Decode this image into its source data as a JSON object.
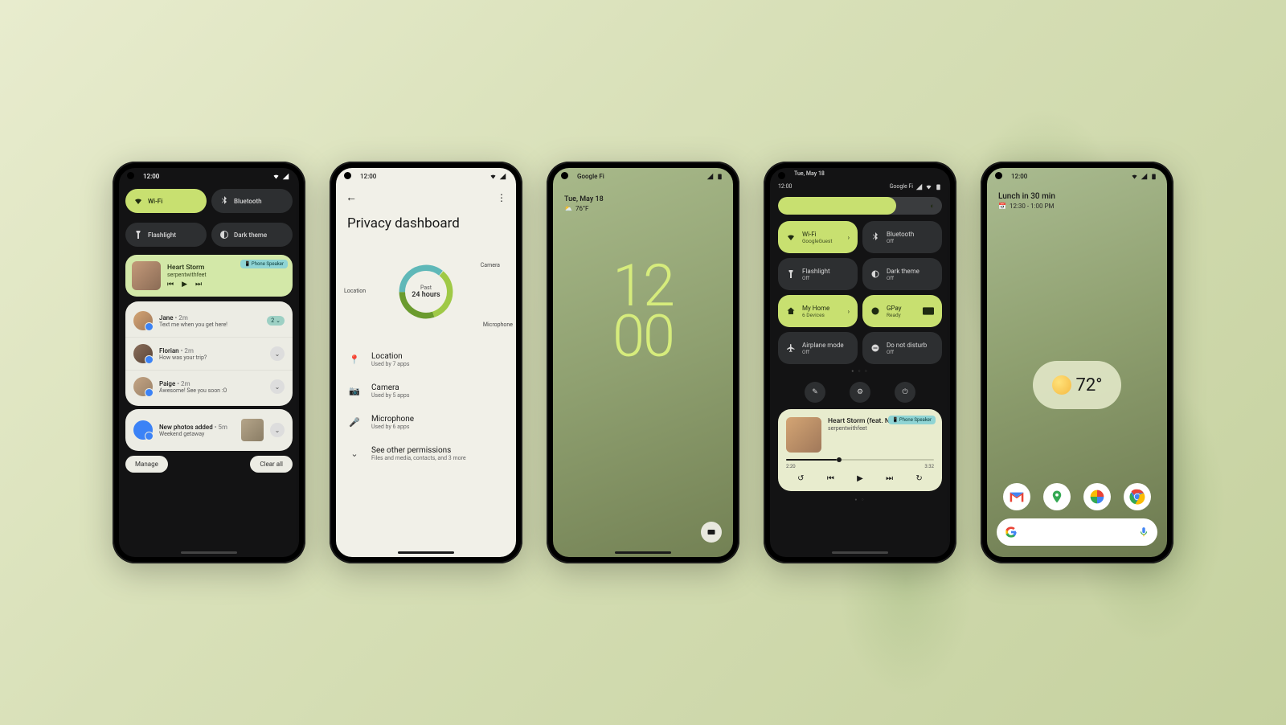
{
  "phone1": {
    "time": "12:00",
    "qs": [
      {
        "label": "Wi-Fi",
        "icon": "wifi-icon",
        "on": true
      },
      {
        "label": "Bluetooth",
        "icon": "bluetooth-icon",
        "on": false
      },
      {
        "label": "Flashlight",
        "icon": "flashlight-icon",
        "on": false
      },
      {
        "label": "Dark theme",
        "icon": "dark-theme-icon",
        "on": false
      }
    ],
    "media": {
      "title": "Heart Storm",
      "artist": "serpentwithfeet",
      "badge": "Phone Speaker"
    },
    "notifications": [
      {
        "name": "Jane",
        "meta": "• 2m",
        "text": "Text me when you get here!",
        "count": "2"
      },
      {
        "name": "Florian",
        "meta": "• 2m",
        "text": "How was your trip?"
      },
      {
        "name": "Paige",
        "meta": "• 2m",
        "text": "Awesome! See you soon :O"
      },
      {
        "name": "New photos added",
        "meta": "• 5m",
        "text": "Weekend getaway",
        "thumb": true
      }
    ],
    "footer": {
      "manage": "Manage",
      "clear": "Clear all"
    }
  },
  "phone2": {
    "time": "12:00",
    "title": "Privacy dashboard",
    "donut": {
      "center_top": "Past",
      "center_bottom": "24 hours",
      "labels": {
        "location": "Location",
        "camera": "Camera",
        "microphone": "Microphone"
      }
    },
    "perms": [
      {
        "icon": "📍",
        "title": "Location",
        "sub": "Used by 7 apps"
      },
      {
        "icon": "📷",
        "title": "Camera",
        "sub": "Used by 5 apps"
      },
      {
        "icon": "🎤",
        "title": "Microphone",
        "sub": "Used by 6 apps"
      },
      {
        "icon": "⌄",
        "title": "See other permissions",
        "sub": "Files and media, contacts, and 3 more"
      }
    ]
  },
  "phone3": {
    "carrier": "Google Fi",
    "date": "Tue, May 18",
    "temp": "76°F",
    "clock_top": "12",
    "clock_bottom": "00"
  },
  "phone4": {
    "date": "Tue, May 18",
    "time": "12:00",
    "carrier": "Google Fi",
    "tiles": [
      {
        "t1": "Wi-Fi",
        "t2": "GoogleGuest",
        "on": true,
        "chev": true
      },
      {
        "t1": "Bluetooth",
        "t2": "Off",
        "on": false
      },
      {
        "t1": "Flashlight",
        "t2": "Off",
        "on": false
      },
      {
        "t1": "Dark theme",
        "t2": "Off",
        "on": false
      },
      {
        "t1": "My Home",
        "t2": "6 Devices",
        "on": true,
        "chev": true
      },
      {
        "t1": "GPay",
        "t2": "Ready",
        "on": true
      },
      {
        "t1": "Airplane mode",
        "t2": "Off",
        "on": false
      },
      {
        "t1": "Do not disturb",
        "t2": "Off",
        "on": false
      }
    ],
    "media": {
      "title": "Heart Storm (feat. NAO)",
      "artist": "serpentwithfeet",
      "badge": "Phone Speaker",
      "elapsed": "2:20",
      "total": "3:32"
    }
  },
  "phone5": {
    "time": "12:00",
    "glance_title": "Lunch in 30 min",
    "glance_time": "12:30 - 1:00 PM",
    "weather_temp": "72°"
  }
}
